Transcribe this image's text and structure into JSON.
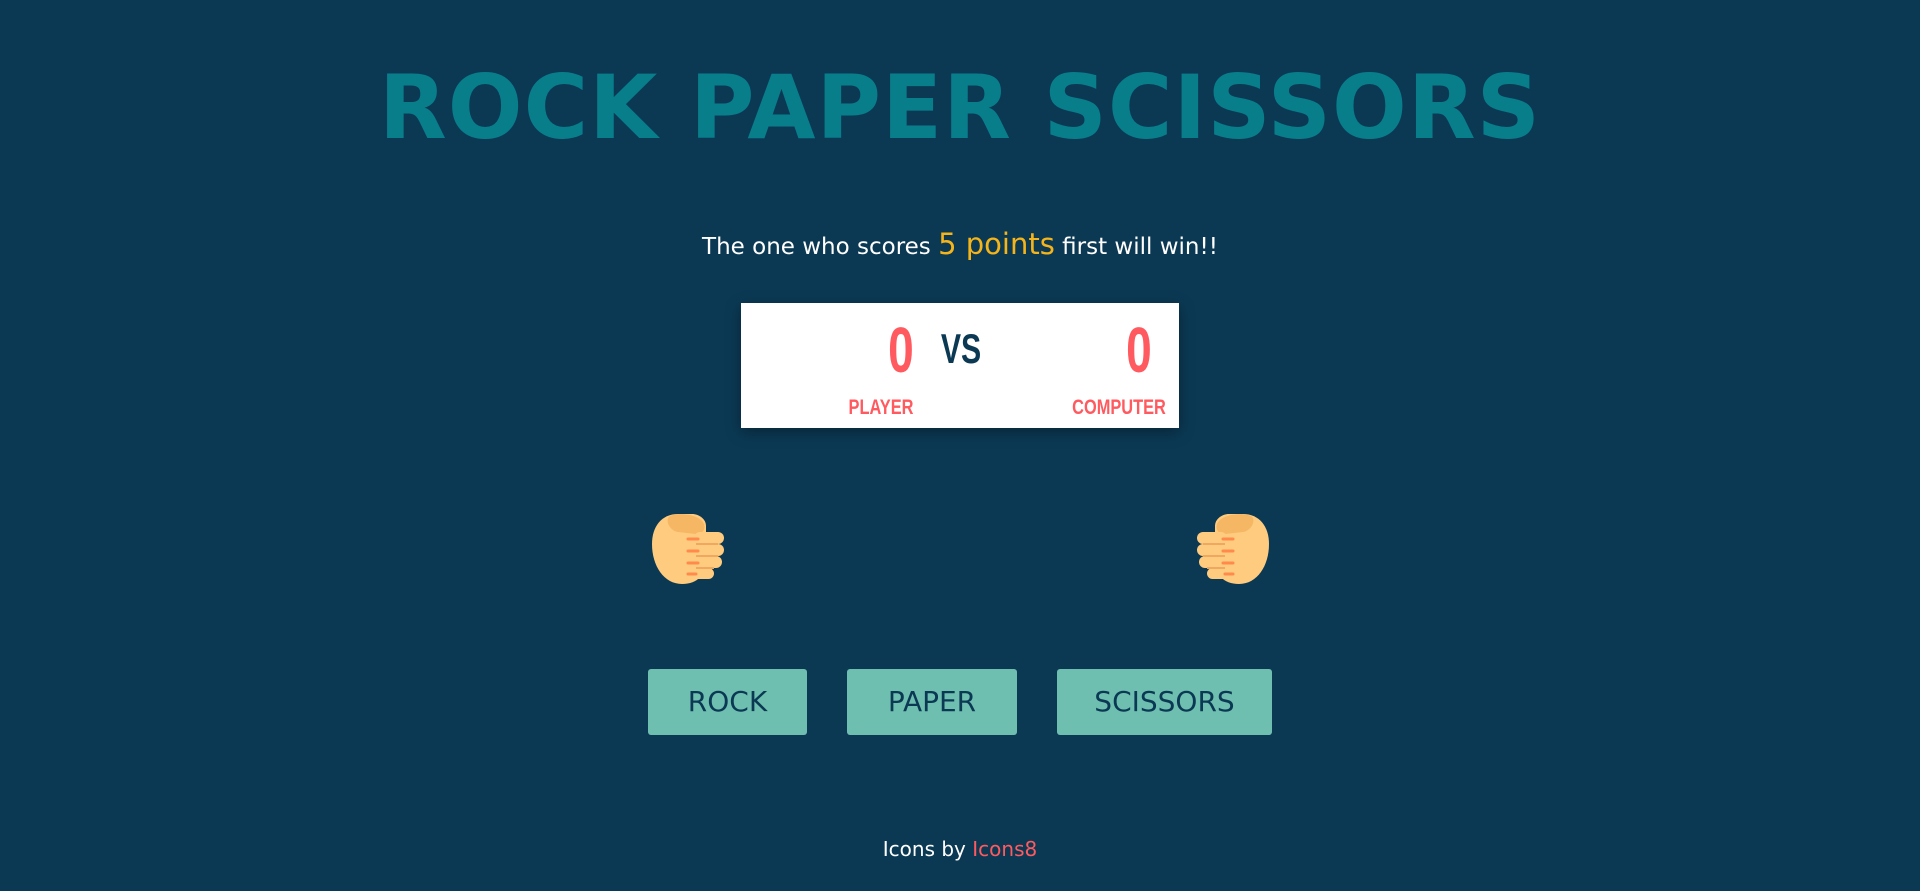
{
  "title": "ROCK PAPER SCISSORS",
  "intro": {
    "prefix": "The one who scores",
    "highlight": "5 points",
    "suffix": "first will win!!"
  },
  "scoreboard": {
    "player_score": "0",
    "vs_label": "VS",
    "computer_score": "0",
    "player_label": "PLAYER",
    "computer_label": "COMPUTER"
  },
  "hands": {
    "player": {
      "icon": "fist-icon",
      "facing": "right"
    },
    "computer": {
      "icon": "fist-icon",
      "facing": "left"
    }
  },
  "buttons": {
    "rock": "ROCK",
    "paper": "PAPER",
    "scissors": "SCISSORS"
  },
  "footer": {
    "text": "Icons by",
    "link": "Icons8"
  },
  "colors": {
    "background": "#0b3954",
    "title": "#087e8b",
    "accent_yellow": "#f4b41a",
    "accent_red": "#ff5a5f",
    "button": "#6fbfb1"
  }
}
